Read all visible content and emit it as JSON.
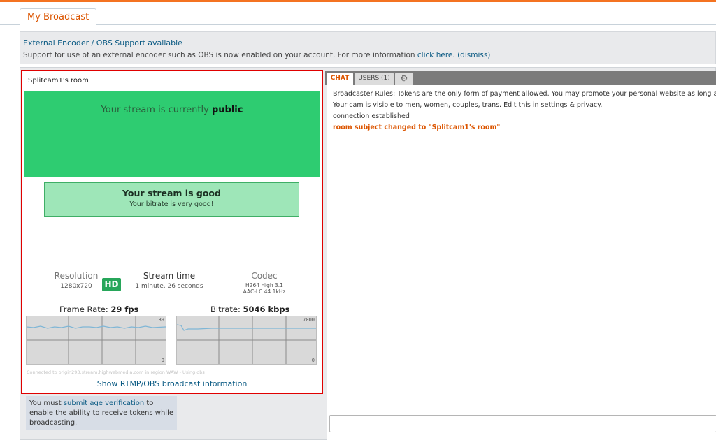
{
  "tabs": {
    "active": "My Broadcast"
  },
  "notice": {
    "title": "External Encoder / OBS Support available",
    "text": "Support for use of an external encoder such as OBS is now enabled on your account. For more information",
    "link_label": "click here.",
    "dismiss_label": "(dismiss)"
  },
  "broadcast": {
    "room_title": "Splitcam1's room",
    "public_prefix": "Your stream is currently",
    "public_status": "public",
    "status_title": "Your stream is good",
    "status_sub": "Your bitrate is very good!",
    "resolution_label": "Resolution",
    "resolution_value": "1280x720",
    "hd_badge": "HD",
    "stream_time_label": "Stream time",
    "stream_time_value": "1 minute, 26 seconds",
    "codec_label": "Codec",
    "codec_video": "H264 High 3.1",
    "codec_audio": "AAC-LC 44.1kHz",
    "framerate_label": "Frame Rate:",
    "framerate_value": "29 fps",
    "framerate_max": "39",
    "framerate_min": "0",
    "bitrate_label": "Bitrate:",
    "bitrate_value": "5046 kbps",
    "bitrate_max": "7000",
    "bitrate_min": "0",
    "server_info": "Connected to origin293.stream.highwebmedia.com in region WAW - Using obs",
    "rtmp_link": "Show RTMP/OBS broadcast information"
  },
  "age": {
    "prefix": "You must",
    "link": "submit age verification",
    "suffix": "to enable the ability to receive tokens while broadcasting."
  },
  "chat": {
    "tab_chat": "CHAT",
    "tab_users": "USERS (1)",
    "tab_settings_icon": "gear-icon",
    "messages": [
      "Broadcaster Rules: Tokens are the only form of payment allowed. You may promote your personal website as long as it d",
      "Your cam is visible to men, women, couples, trans. Edit this in settings & privacy.",
      "connection established",
      "room subject changed to \"Splitcam1's room\""
    ]
  },
  "colors": {
    "accent": "#dc5500",
    "green": "#2ecc71",
    "link": "#0a5a83",
    "highlight_border": "#e00000"
  }
}
